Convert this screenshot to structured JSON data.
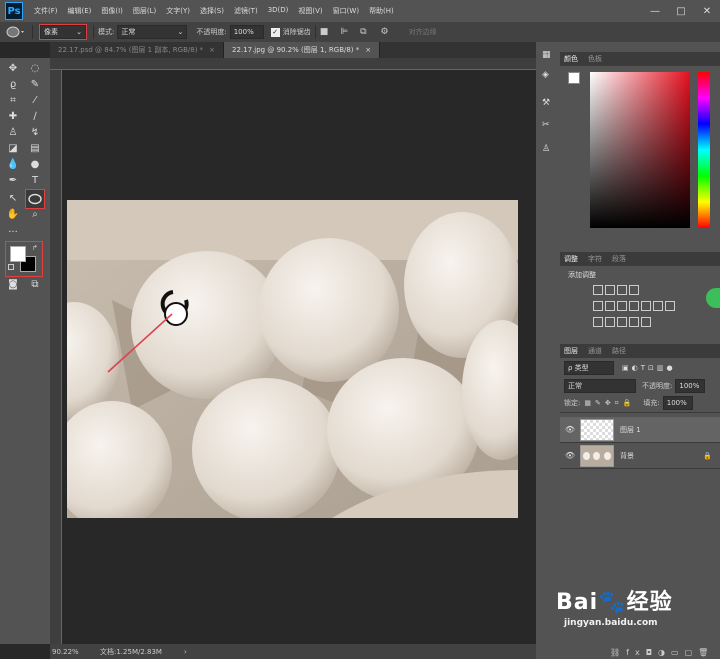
{
  "app": {
    "logo": "Ps"
  },
  "menu": [
    "文件(F)",
    "编辑(E)",
    "图像(I)",
    "图层(L)",
    "文字(Y)",
    "选择(S)",
    "滤镜(T)",
    "3D(D)",
    "视图(V)",
    "窗口(W)",
    "帮助(H)"
  ],
  "window_controls": [
    "—",
    "□",
    "✕"
  ],
  "options": {
    "pixel_mode": "像素",
    "mode_label": "模式:",
    "mode_value": "正常",
    "opacity_label": "不透明度:",
    "opacity_value": "100%",
    "antialias_label": "消除锯齿",
    "align_edges_label": "对齐边缘"
  },
  "tabs": [
    "22.17.psd @ 84.7% (图层 1 副本, RGB/8) *",
    "22.17.jpg @ 90.2% (图层 1, RGB/8) *"
  ],
  "status": {
    "zoom": "90.22%",
    "doc": "文档:1.25M/2.83M"
  },
  "color_panel": {
    "tabs": [
      "颜色",
      "色板"
    ]
  },
  "adjust_panel": {
    "tabs": [
      "调整",
      "字符",
      "段落"
    ],
    "title": "添加调整"
  },
  "layers_panel": {
    "tabs": [
      "图层",
      "通道",
      "路径"
    ],
    "filter": "ρ 类型",
    "blend": "正常",
    "opacity_label": "不透明度:",
    "opacity_value": "100%",
    "lock_label": "锁定:",
    "fill_label": "填充:",
    "fill_value": "100%",
    "layers": [
      {
        "name": "图层 1",
        "selected": true
      },
      {
        "name": "背景",
        "locked": true
      }
    ]
  },
  "colors": {
    "accent": "#e04040",
    "menubar": "#535353",
    "panel": "#535353"
  },
  "watermark": "Bai 经验 jingyan.baidu.com"
}
